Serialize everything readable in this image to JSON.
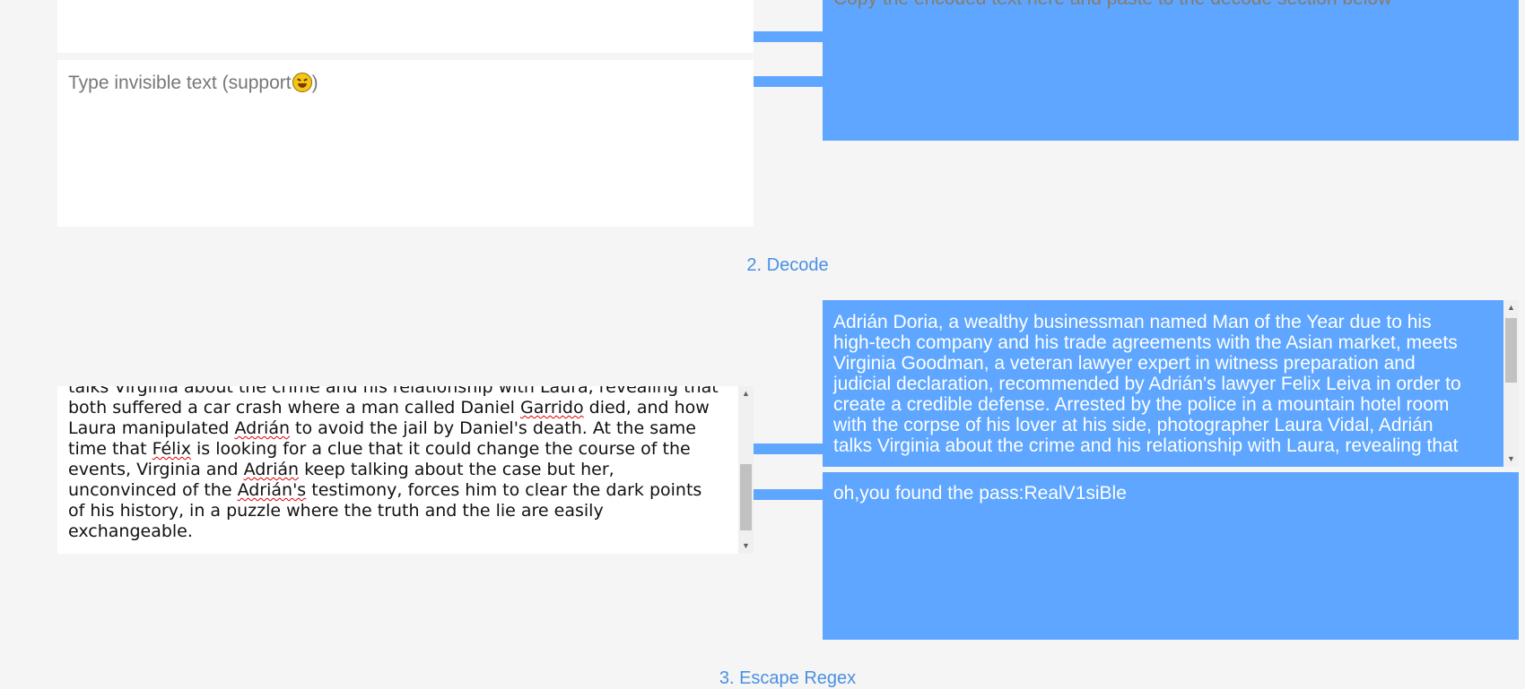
{
  "encode": {
    "top_panel_hint": "Copy the encoded text here and paste to the decode section below",
    "invisible_placeholder": "Type invisible text (support",
    "invisible_placeholder_suffix": ")"
  },
  "decode": {
    "section_title": "2. Decode",
    "input_lines": [
      "talks Virginia about the crime and his relationship with Laura, revealing that",
      "both suffered a car crash where a man called Daniel Garrido died, and how",
      "Laura manipulated Adrián to avoid the jail by Daniel's death. At the same",
      "time that Félix is looking for a clue that it could change the course of the",
      "events, Virginia and Adrián keep talking about the case but her,",
      "unconvinced of the Adrián's testimony, forces him to clear the dark points",
      "of his history, in a puzzle where the truth and the lie are easily",
      "exchangeable."
    ],
    "output_lines": [
      "Adrián Doria, a wealthy businessman named Man of the Year due to his",
      "high-tech company and his trade agreements with the Asian market, meets",
      "Virginia Goodman, a veteran lawyer expert in witness preparation and",
      "judicial declaration, recommended by Adrián's lawyer Felix Leiva in order to",
      "create a credible defense. Arrested by the police in a mountain hotel room",
      "with the corpse of his lover at his side, photographer Laura Vidal, Adrián",
      "talks Virginia about the crime and his relationship with Laura, revealing that"
    ],
    "hidden_result": "oh,you found the pass:RealV1siBle"
  },
  "escape": {
    "section_title": "3. Escape Regex"
  },
  "colors": {
    "accent": "#5ea6ff",
    "title": "#4a90e2",
    "background": "#f5f5f5"
  }
}
